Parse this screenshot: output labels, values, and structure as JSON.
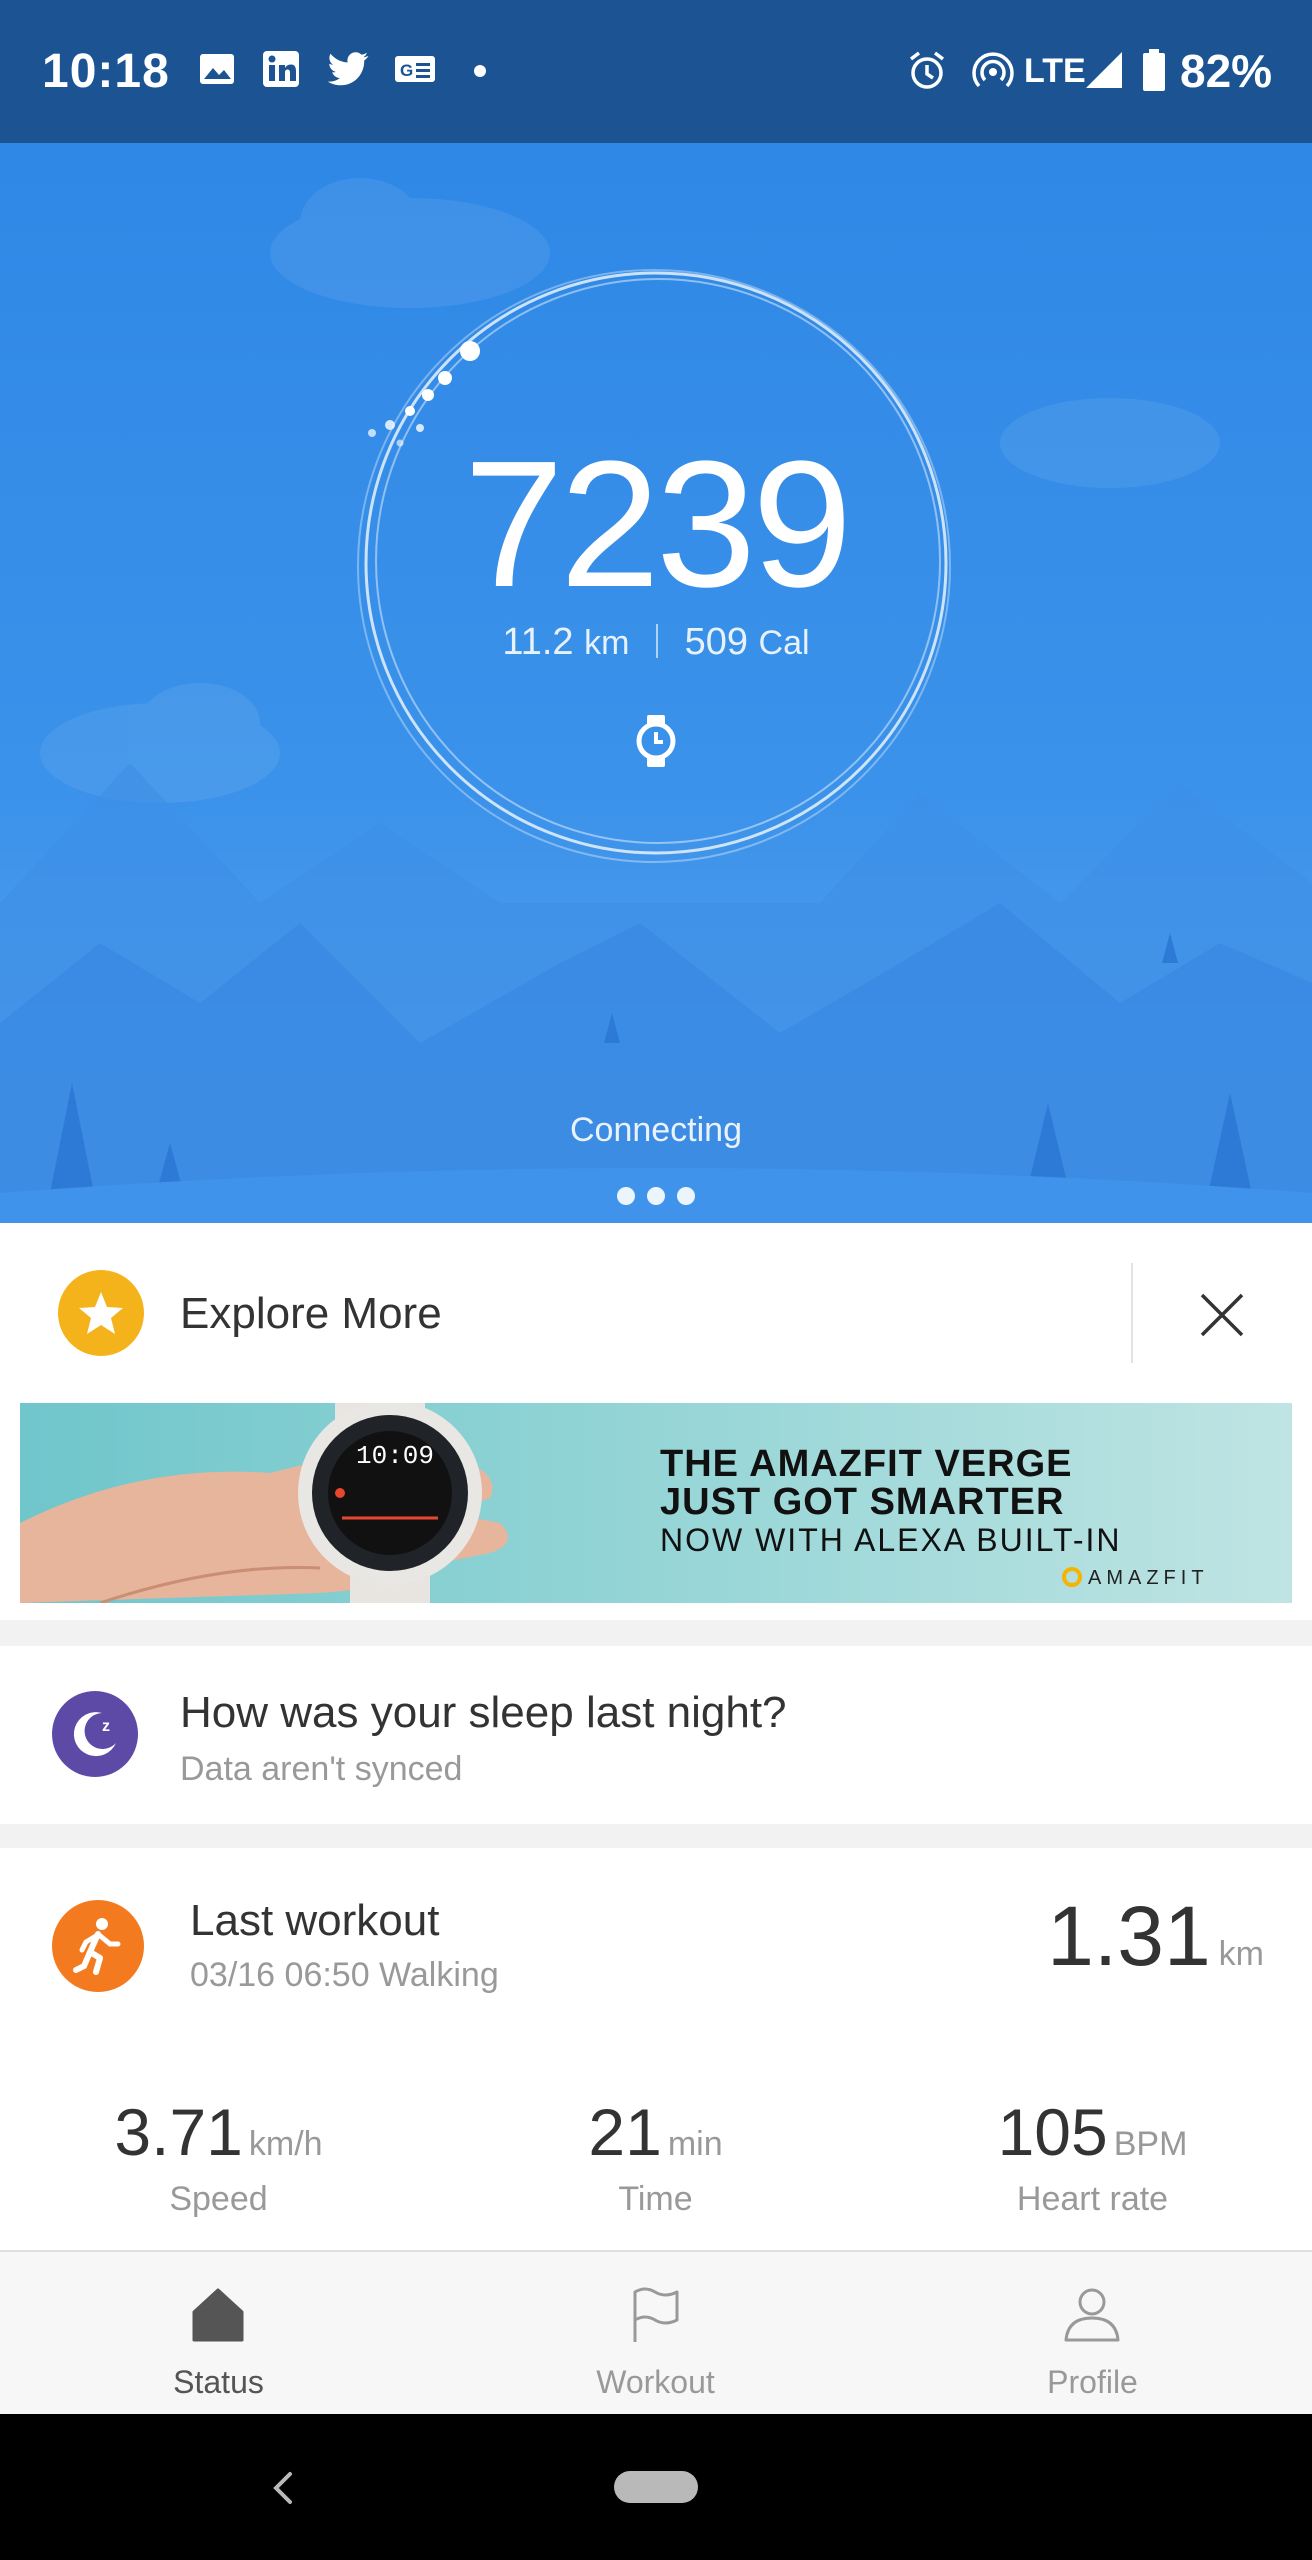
{
  "status_bar": {
    "time": "10:18",
    "network": "LTE",
    "battery": "82%",
    "notification_icons": [
      "image-icon",
      "linkedin-icon",
      "twitter-icon",
      "news-icon",
      "dot-icon"
    ],
    "system_icons": [
      "alarm-icon",
      "hotspot-icon",
      "signal-icon",
      "battery-icon"
    ]
  },
  "hero": {
    "steps": "7239",
    "distance_value": "11.2",
    "distance_unit": "km",
    "calories_value": "509",
    "calories_unit": "Cal",
    "device_icon": "watch-icon",
    "status": "Connecting",
    "page_dots": 3
  },
  "explore": {
    "title": "Explore More",
    "icon": "star-icon",
    "close_icon": "close-icon",
    "banner": {
      "line1": "THE AMAZFIT VERGE",
      "line2": "JUST GOT SMARTER",
      "line3": "NOW WITH ALEXA BUILT-IN",
      "brand": "AMAZFIT"
    }
  },
  "sleep": {
    "title": "How was your sleep last night?",
    "subtitle": "Data aren't synced",
    "icon": "moon-icon"
  },
  "workout": {
    "title": "Last workout",
    "subtitle": "03/16 06:50 Walking",
    "distance": "1.31",
    "distance_unit": "km",
    "icon": "walking-icon",
    "metrics": [
      {
        "value": "3.71",
        "unit": "km/h",
        "label": "Speed"
      },
      {
        "value": "21",
        "unit": "min",
        "label": "Time"
      },
      {
        "value": "105",
        "unit": "BPM",
        "label": "Heart rate"
      }
    ]
  },
  "bottom_nav": [
    {
      "label": "Status",
      "icon": "home-icon",
      "active": true
    },
    {
      "label": "Workout",
      "icon": "flag-icon",
      "active": false
    },
    {
      "label": "Profile",
      "icon": "person-icon",
      "active": false
    }
  ],
  "colors": {
    "status_bar": "#1c5493",
    "hero_blue": "#2f88e6",
    "explore_accent": "#f5b31b",
    "sleep_accent": "#5d4aa6",
    "workout_accent": "#f47a1f"
  }
}
